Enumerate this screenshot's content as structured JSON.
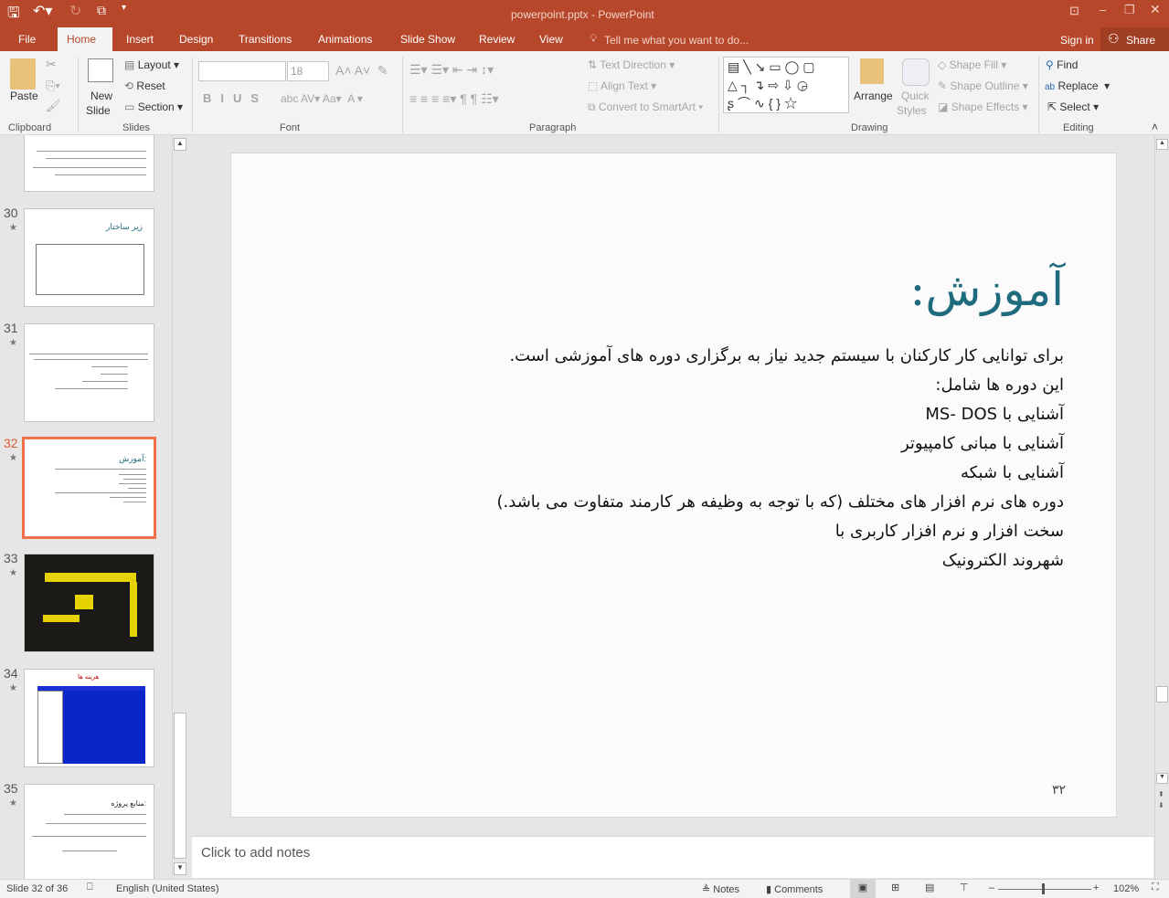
{
  "titlebar": {
    "title": "powerpoint.pptx - PowerPoint"
  },
  "qat": {
    "save_icon": "save-icon",
    "undo_icon": "undo-icon",
    "redo_icon": "redo-icon",
    "present_icon": "present-icon"
  },
  "tabs": [
    {
      "label": "File"
    },
    {
      "label": "Home"
    },
    {
      "label": "Insert"
    },
    {
      "label": "Design"
    },
    {
      "label": "Transitions"
    },
    {
      "label": "Animations"
    },
    {
      "label": "Slide Show"
    },
    {
      "label": "Review"
    },
    {
      "label": "View"
    }
  ],
  "tell_me": "Tell me what you want to do...",
  "sign_in": "Sign in",
  "share": "Share",
  "ribbon": {
    "clipboard": {
      "paste": "Paste",
      "label": "Clipboard"
    },
    "slides": {
      "new_slide_1": "New",
      "new_slide_2": "Slide",
      "layout": "Layout",
      "reset": "Reset",
      "section": "Section",
      "label": "Slides"
    },
    "font": {
      "font_name": "",
      "font_size": "18",
      "label": "Font"
    },
    "paragraph": {
      "text_direction": "Text Direction",
      "align_text": "Align Text",
      "convert_smartart": "Convert to SmartArt",
      "label": "Paragraph"
    },
    "drawing": {
      "arrange": "Arrange",
      "quick_styles_1": "Quick",
      "quick_styles_2": "Styles",
      "shape_fill": "Shape Fill",
      "shape_outline": "Shape Outline",
      "shape_effects": "Shape Effects",
      "label": "Drawing"
    },
    "editing": {
      "find": "Find",
      "replace": "Replace",
      "select": "Select",
      "label": "Editing"
    }
  },
  "thumbnails": [
    {
      "number": "30"
    },
    {
      "number": "31"
    },
    {
      "number": "32",
      "selected": true
    },
    {
      "number": "33"
    },
    {
      "number": "34"
    },
    {
      "number": "35"
    }
  ],
  "thumb_texts": {
    "t30_title": "زیر ساختار",
    "t32_title": "آموزش:",
    "t34_title": "هزینه ها",
    "t35_title": "منابع پروژه:"
  },
  "slide": {
    "title": "آموزش:",
    "body": [
      "برای توانایی کار کارکنان با سیستم جدید نیاز به برگزاری دوره های آموزشی است.",
      "این دوره ها شامل:",
      "آشنایی با MS- DOS",
      "آشنایی با مبانی کامپیوتر",
      "آشنایی با شبکه",
      "دوره های نرم افزار های مختلف (که با توجه به وظیفه هر کارمند متفاوت می باشد.)",
      "سخت افزار و نرم افزار  کاربری با",
      "شهروند الکترونیک"
    ],
    "page_number": "۳۲",
    "title_color": "#1f6b7e"
  },
  "notes_placeholder": "Click to add notes",
  "status": {
    "slide_info": "Slide 32 of 36",
    "language": "English (United States)",
    "notes": "Notes",
    "comments": "Comments",
    "zoom": "102%"
  },
  "colors": {
    "accent": "#b7472a",
    "selected_thumb": "#f0704a"
  }
}
